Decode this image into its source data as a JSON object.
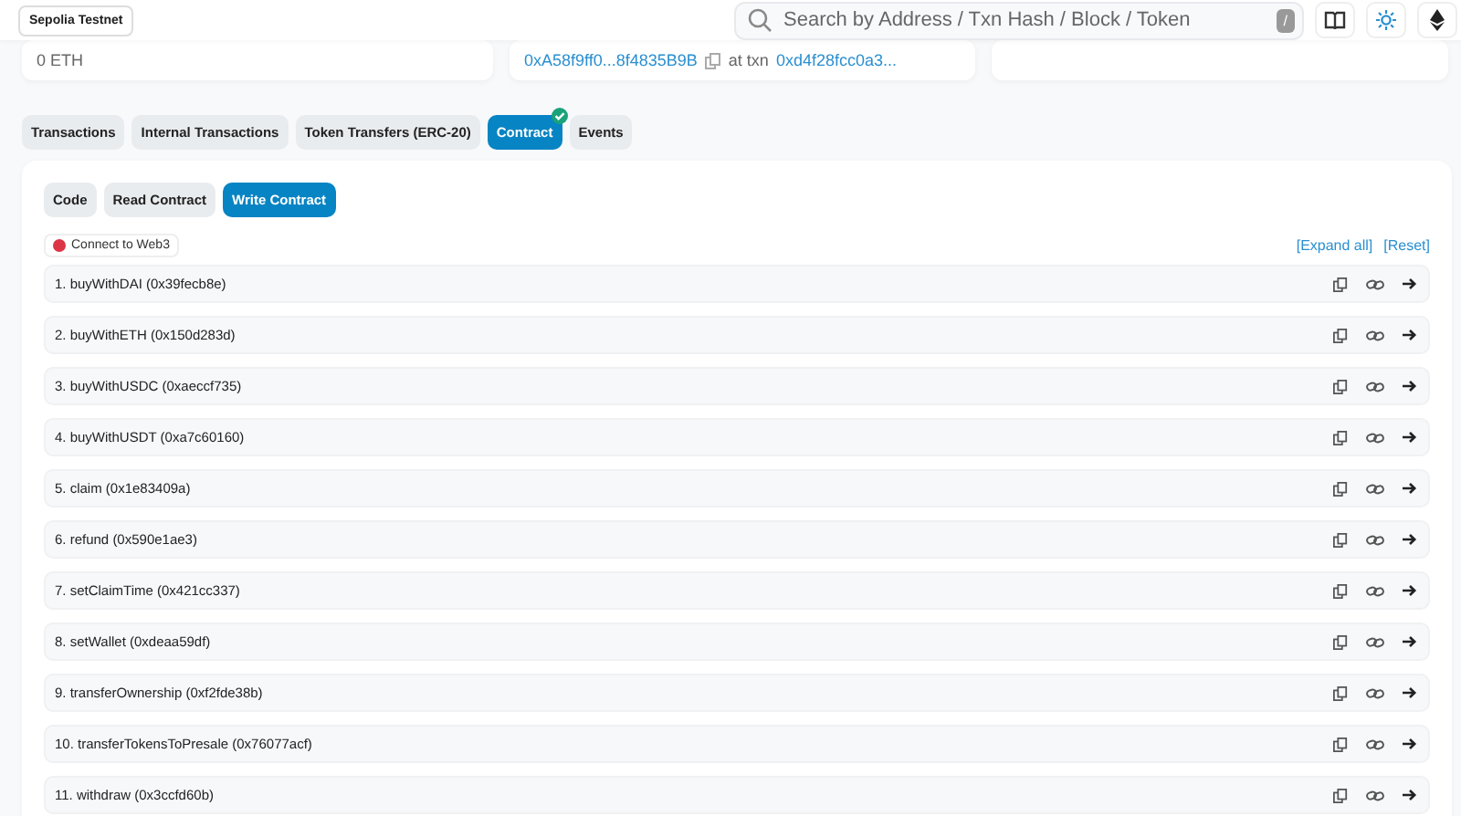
{
  "header": {
    "network_badge": "Sepolia Testnet",
    "search": {
      "placeholder": "Search by Address / Txn Hash / Block / Token",
      "shortcut": "/"
    }
  },
  "overview": {
    "balance": "0 ETH",
    "creator_address": "0xA58f9ff0...8f4835B9B",
    "txn_label": "at txn",
    "creator_txn": "0xd4f28fcc0a3..."
  },
  "tabs": [
    {
      "label": "Transactions",
      "selected": false,
      "verified": false
    },
    {
      "label": "Internal Transactions",
      "selected": false,
      "verified": false
    },
    {
      "label": "Token Transfers (ERC-20)",
      "selected": false,
      "verified": false
    },
    {
      "label": "Contract",
      "selected": true,
      "verified": true
    },
    {
      "label": "Events",
      "selected": false,
      "verified": false
    }
  ],
  "subtabs": [
    {
      "label": "Code",
      "selected": false
    },
    {
      "label": "Read Contract",
      "selected": false
    },
    {
      "label": "Write Contract",
      "selected": true
    }
  ],
  "connect": {
    "label": "Connect to Web3",
    "connected": false
  },
  "expand_all": "[Expand all]",
  "reset": "[Reset]",
  "functions": [
    "1. buyWithDAI (0x39fecb8e)",
    "2. buyWithETH (0x150d283d)",
    "3. buyWithUSDC (0xaeccf735)",
    "4. buyWithUSDT (0xa7c60160)",
    "5. claim (0x1e83409a)",
    "6. refund (0x590e1ae3)",
    "7. setClaimTime (0x421cc337)",
    "8. setWallet (0xdeaa59df)",
    "9. transferOwnership (0xf2fde38b)",
    "10. transferTokensToPresale (0x76077acf)",
    "11. withdraw (0x3ccfd60b)"
  ]
}
